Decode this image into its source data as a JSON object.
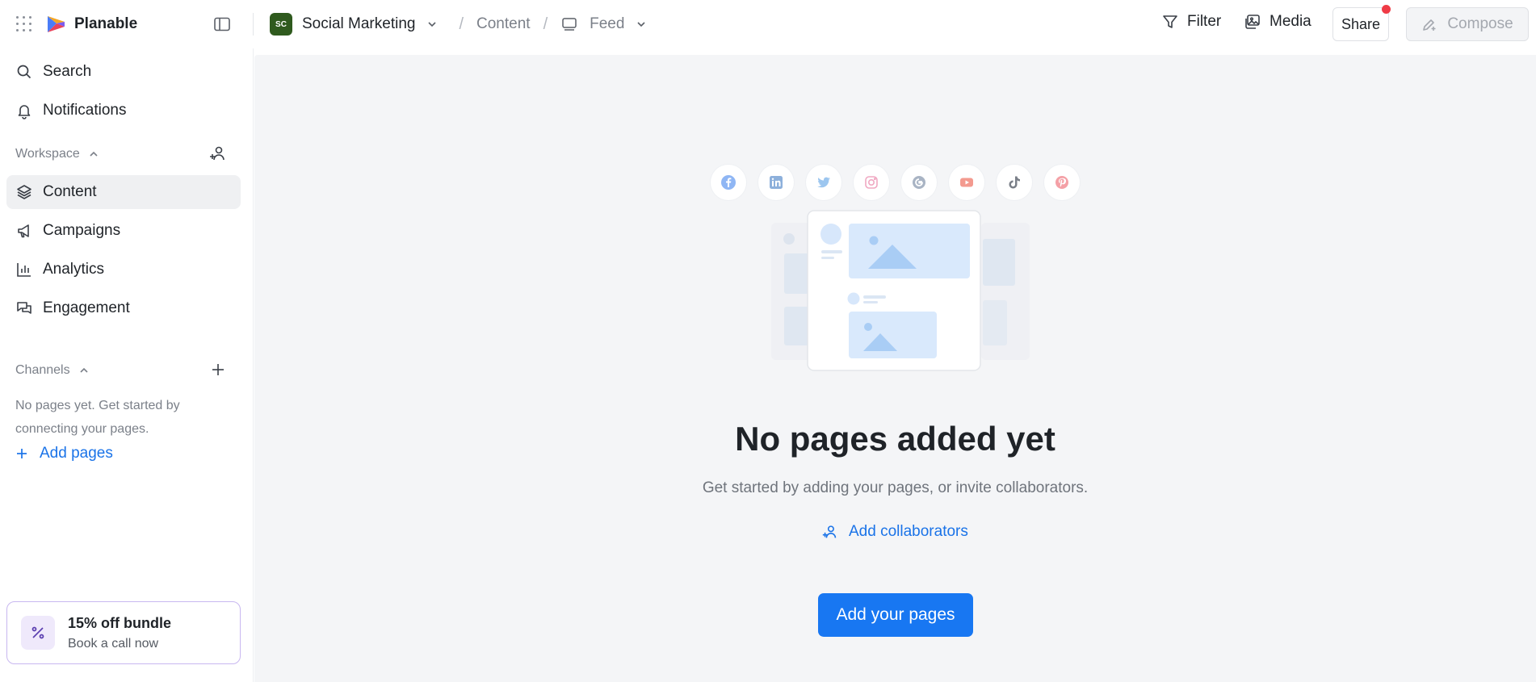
{
  "app": {
    "name": "Planable"
  },
  "breadcrumb": {
    "workspace_initials": "SC",
    "workspace_name": "Social Marketing",
    "separator": "/",
    "section": "Content",
    "view": "Feed"
  },
  "toolbar": {
    "filter_label": "Filter",
    "media_label": "Media",
    "share_label": "Share",
    "compose_label": "Compose"
  },
  "sidebar": {
    "top_items": [
      {
        "label": "Search",
        "icon": "search-icon"
      },
      {
        "label": "Notifications",
        "icon": "bell-icon"
      }
    ],
    "workspace_section": {
      "label": "Workspace"
    },
    "workspace_items": [
      {
        "label": "Content",
        "icon": "layers-icon",
        "active": true
      },
      {
        "label": "Campaigns",
        "icon": "megaphone-icon"
      },
      {
        "label": "Analytics",
        "icon": "bar-chart-icon"
      },
      {
        "label": "Engagement",
        "icon": "chat-icon"
      }
    ],
    "channels_section": {
      "label": "Channels"
    },
    "channels_empty_text": "No pages yet. Get started by connecting your pages.",
    "add_pages_label": "Add pages",
    "promo": {
      "title": "15% off bundle",
      "subtitle": "Book a call now",
      "icon": "percent-icon"
    }
  },
  "main": {
    "social_icons": [
      "facebook-icon",
      "linkedin-icon",
      "twitter-icon",
      "instagram-icon",
      "google-icon",
      "youtube-icon",
      "tiktok-icon",
      "pinterest-icon"
    ],
    "empty_title": "No pages added yet",
    "empty_subtitle": "Get started by adding your pages, or invite collaborators.",
    "add_collaborators_label": "Add collaborators",
    "add_pages_button_label": "Add your pages"
  },
  "colors": {
    "accent": "#1877f2",
    "link": "#1a73e8",
    "workspace_avatar": "#2f5a1e",
    "notification_dot": "#ef3b46",
    "promo_border": "#c8b7f0"
  }
}
